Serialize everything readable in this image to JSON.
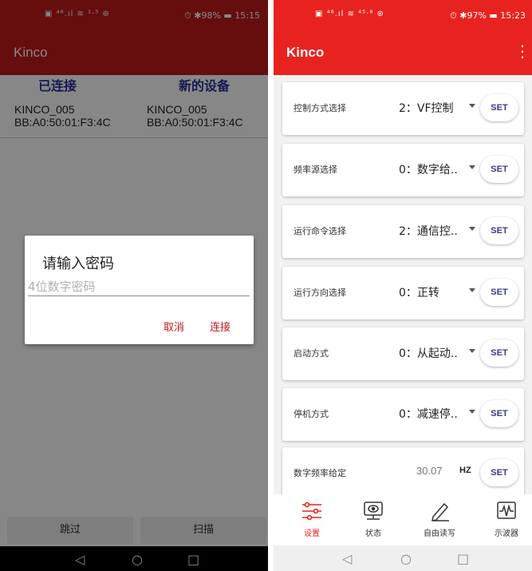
{
  "left": {
    "statusbar": {
      "icons": "▣ ⁴⁶.ıl ≋ ¹·⁵ ⊛",
      "right": "⏱ ✱98% ▬ 15:15"
    },
    "appbar": {
      "title": "Kinco"
    },
    "columns": {
      "connected": {
        "header": "已连接",
        "name": "KINCO_005",
        "mac": "BB:A0:50:01:F3:4C"
      },
      "new_device": {
        "header": "新的设备",
        "name": "KINCO_005",
        "mac": "BB:A0:50:01:F3:4C"
      }
    },
    "dialog": {
      "title": "请输入密码",
      "placeholder": "4位数字密码",
      "cancel": "取消",
      "connect": "连接"
    },
    "bottom": {
      "skip": "跳过",
      "scan": "扫描"
    },
    "navbar": {
      "back": "◁",
      "home": "○",
      "recent": "□"
    }
  },
  "right": {
    "statusbar": {
      "icons": "▣ ⁴⁶.ıl ≋ ⁴⁵·⁸ ⊛",
      "right": "⏱ ✱97% ▬ 15:23"
    },
    "appbar": {
      "title": "Kinco",
      "menu": "⋮"
    },
    "settings": [
      {
        "label": "控制方式选择",
        "value": "2：VF控制",
        "button": "SET"
      },
      {
        "label": "频率源选择",
        "value": "0：数字给..",
        "button": "SET"
      },
      {
        "label": "运行命令选择",
        "value": "2：通信控..",
        "button": "SET"
      },
      {
        "label": "运行方向选择",
        "value": "0：正转",
        "button": "SET"
      },
      {
        "label": "启动方式",
        "value": "0：从起动..",
        "button": "SET"
      },
      {
        "label": "停机方式",
        "value": "0：减速停..",
        "button": "SET"
      }
    ],
    "frequency": {
      "label": "数字频率给定",
      "value": "30.07",
      "unit": "HZ",
      "button": "SET"
    },
    "tabs": [
      {
        "label": "设置",
        "icon": "settings-sliders-icon",
        "active": true
      },
      {
        "label": "状态",
        "icon": "monitor-icon",
        "active": false
      },
      {
        "label": "自由读写",
        "icon": "pen-icon",
        "active": false
      },
      {
        "label": "示波器",
        "icon": "waveform-icon",
        "active": false
      }
    ],
    "navbar": {
      "back": "◁",
      "home": "○",
      "recent": "□"
    }
  },
  "colors": {
    "left_accent": "#c0191b",
    "right_accent": "#e8231f",
    "header_blue": "#2d2f9e",
    "set_text": "#3a3a8c"
  }
}
